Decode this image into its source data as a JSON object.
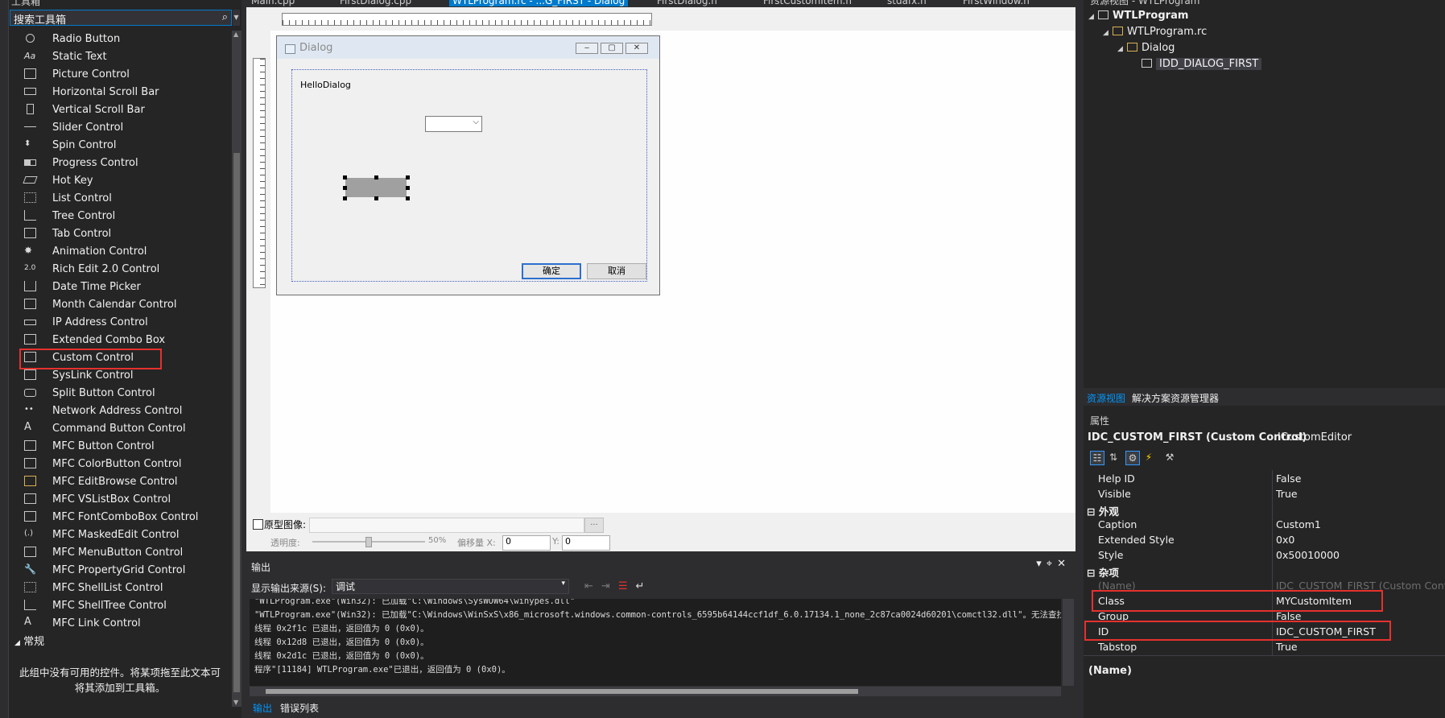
{
  "toolbox": {
    "title": "工具箱",
    "search_placeholder": "搜索工具箱",
    "items": [
      {
        "label": "Radio Button"
      },
      {
        "label": "Static Text"
      },
      {
        "label": "Picture Control"
      },
      {
        "label": "Horizontal Scroll Bar"
      },
      {
        "label": "Vertical Scroll Bar"
      },
      {
        "label": "Slider Control"
      },
      {
        "label": "Spin Control"
      },
      {
        "label": "Progress Control"
      },
      {
        "label": "Hot Key"
      },
      {
        "label": "List Control"
      },
      {
        "label": "Tree Control"
      },
      {
        "label": "Tab Control"
      },
      {
        "label": "Animation Control"
      },
      {
        "label": "Rich Edit 2.0 Control"
      },
      {
        "label": "Date Time Picker"
      },
      {
        "label": "Month Calendar Control"
      },
      {
        "label": "IP Address Control"
      },
      {
        "label": "Extended Combo Box"
      },
      {
        "label": "Custom Control"
      },
      {
        "label": "SysLink Control"
      },
      {
        "label": "Split Button Control"
      },
      {
        "label": "Network Address Control"
      },
      {
        "label": "Command Button Control"
      },
      {
        "label": "MFC Button Control"
      },
      {
        "label": "MFC ColorButton Control"
      },
      {
        "label": "MFC EditBrowse Control"
      },
      {
        "label": "MFC VSListBox Control"
      },
      {
        "label": "MFC FontComboBox Control"
      },
      {
        "label": "MFC MaskedEdit Control"
      },
      {
        "label": "MFC MenuButton Control"
      },
      {
        "label": "MFC PropertyGrid Control"
      },
      {
        "label": "MFC ShellList Control"
      },
      {
        "label": "MFC ShellTree Control"
      },
      {
        "label": "MFC Link Control"
      }
    ],
    "group_label": "常规",
    "empty_message": "此组中没有可用的控件。将某项拖至此文本可将其添加到工具箱。"
  },
  "tabs": [
    {
      "label": "Main.cpp"
    },
    {
      "label": "FirstDialog.cpp"
    },
    {
      "label": "WTLProgram.rc - ...G_FIRST - Dialog"
    },
    {
      "label": "FirstDialog.h"
    },
    {
      "label": "FirstCustomItem.h"
    },
    {
      "label": "stdafx.h"
    },
    {
      "label": "FirstWindow.h"
    }
  ],
  "dialog": {
    "title": "Dialog",
    "static_text": "HelloDialog",
    "ok_label": "确定",
    "cancel_label": "取消"
  },
  "proto_bar": {
    "label": "原型图像:",
    "browse": "...",
    "opacity_label": "透明度:",
    "opacity_pct": "50%",
    "offset_label": "偏移量 X:",
    "x_value": "0",
    "y_label": "Y:",
    "y_value": "0"
  },
  "output": {
    "title": "输出",
    "source_label": "显示输出来源(S):",
    "source_value": "调试",
    "lines": [
      "\"WTLProgram.exe\"(Win32): 已加载\"C:\\Windows\\SysWOW64\\winypes.dll\"",
      "\"WTLProgram.exe\"(Win32): 已加载\"C:\\Windows\\WinSxS\\x86_microsoft.windows.common-controls_6595b64144ccf1df_6.0.17134.1_none_2c87ca0024d60201\\comctl32.dll\"。无法查找",
      "线程 0x2f1c 已退出，返回值为 0 (0x0)。",
      "线程 0x12d8 已退出，返回值为 0 (0x0)。",
      "线程 0x2d1c 已退出，返回值为 0 (0x0)。",
      "程序\"[11184] WTLProgram.exe\"已退出，返回值为 0 (0x0)。"
    ],
    "tab_output": "输出",
    "tab_errors": "错误列表"
  },
  "resource_view": {
    "title": "资源视图 - WTLProgram",
    "tree": [
      {
        "label": "WTLProgram"
      },
      {
        "label": "WTLProgram.rc"
      },
      {
        "label": "Dialog"
      },
      {
        "label": "IDD_DIALOG_FIRST"
      }
    ],
    "tab_resource": "资源视图",
    "tab_solution": "解决方案资源管理器"
  },
  "properties": {
    "title": "属性",
    "object": "IDC_CUSTOM_FIRST (Custom Control)",
    "object_type": "ICustomEditor",
    "rows_top": [
      {
        "name": "Help ID",
        "value": "False"
      },
      {
        "name": "Visible",
        "value": "True"
      }
    ],
    "cat_appearance": "外观",
    "rows_appearance": [
      {
        "name": "Caption",
        "value": "Custom1"
      },
      {
        "name": "Extended Style",
        "value": "0x0"
      },
      {
        "name": "Style",
        "value": "0x50010000"
      }
    ],
    "cat_misc": "杂项",
    "rows_misc": [
      {
        "name": "(Name)",
        "value": "IDC_CUSTOM_FIRST (Custom Control)"
      },
      {
        "name": "Class",
        "value": "MYCustomItem"
      },
      {
        "name": "Group",
        "value": "False"
      },
      {
        "name": "ID",
        "value": "IDC_CUSTOM_FIRST"
      },
      {
        "name": "Tabstop",
        "value": "True"
      }
    ],
    "description_title": "(Name)"
  },
  "colors": {
    "accent": "#007acc",
    "highlight_box": "#e5312d",
    "link_blue": "#0097fb"
  }
}
